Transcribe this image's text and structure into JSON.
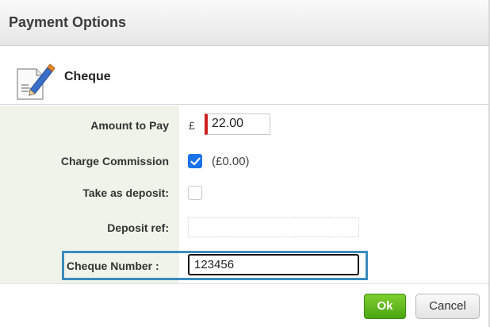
{
  "dialog": {
    "title": "Payment Options"
  },
  "section": {
    "title": "Cheque",
    "icon": "document-pencil-icon"
  },
  "form": {
    "amount": {
      "label": "Amount to Pay",
      "currency": "£",
      "value": "22.00"
    },
    "commission": {
      "label": "Charge Commission",
      "checked": true,
      "amount": "(£0.00)"
    },
    "deposit": {
      "label": "Take as deposit:",
      "checked": false
    },
    "deposit_ref": {
      "label": "Deposit ref:",
      "value": ""
    },
    "cheque_number": {
      "label": "Cheque Number :",
      "value": "123456"
    }
  },
  "footer": {
    "ok_label": "Ok",
    "cancel_label": "Cancel"
  },
  "colors": {
    "ok_green": "#5cb81c",
    "highlight_blue": "#3a8cc0",
    "required_red": "#cc1f1f",
    "checkbox_blue": "#1a73e8",
    "label_panel": "#f0f3ea"
  }
}
